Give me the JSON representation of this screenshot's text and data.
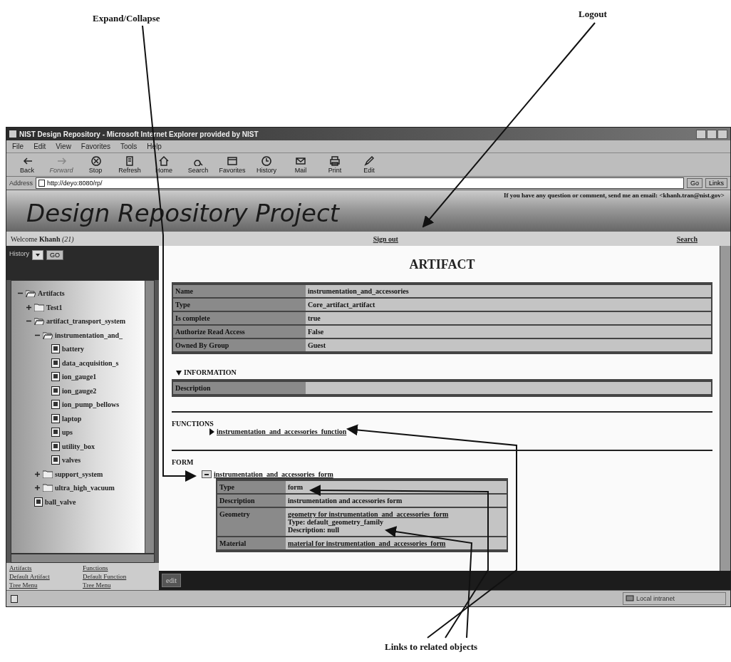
{
  "annotations": [
    {
      "kind": "label",
      "text": "Expand/Collapse"
    },
    {
      "kind": "label",
      "text": "Logout"
    },
    {
      "kind": "label",
      "text": "Links to related objects"
    }
  ],
  "window": {
    "title": "NIST Design Repository - Microsoft Internet Explorer provided by NIST"
  },
  "menu": [
    "File",
    "Edit",
    "View",
    "Favorites",
    "Tools",
    "Help"
  ],
  "toolbar": [
    {
      "label": "Back",
      "disabled": false
    },
    {
      "label": "Forward",
      "disabled": true
    },
    {
      "label": "Stop",
      "disabled": false
    },
    {
      "label": "Refresh",
      "disabled": false
    },
    {
      "label": "Home",
      "disabled": false
    },
    {
      "label": "Search",
      "disabled": false
    },
    {
      "label": "Favorites",
      "disabled": false
    },
    {
      "label": "History",
      "disabled": false
    },
    {
      "label": "Mail",
      "disabled": false
    },
    {
      "label": "Print",
      "disabled": false
    },
    {
      "label": "Edit",
      "disabled": false
    }
  ],
  "address_bar": {
    "label": "Address",
    "value": "http://deyo:8080/rp/",
    "go": "Go",
    "links": "Links"
  },
  "banner": {
    "contact": "If you have any question or comment, send me an email: <khanh.tran@nist.gov>",
    "title": "Design Repository Project"
  },
  "nav": {
    "welcome": "Welcome **Khanh** *(21)*",
    "sign_out": "Sign out",
    "search": "Search"
  },
  "sidebar": {
    "history_label": "History",
    "go": "GO",
    "tree": [
      {
        "label": "Artifacts",
        "kind": "folder",
        "expanded": true,
        "children": [
          {
            "label": "Test1",
            "kind": "folder",
            "expanded": false
          },
          {
            "label": "artifact_transport_system",
            "kind": "folder",
            "expanded": true,
            "children": [
              {
                "label": "instrumentation_and_",
                "kind": "folder",
                "expanded": true,
                "children": [
                  {
                    "label": "battery",
                    "kind": "file"
                  },
                  {
                    "label": "data_acquisition_s",
                    "kind": "file"
                  },
                  {
                    "label": "ion_gauge1",
                    "kind": "file"
                  },
                  {
                    "label": "ion_gauge2",
                    "kind": "file"
                  },
                  {
                    "label": "ion_pump_bellows",
                    "kind": "file"
                  },
                  {
                    "label": "laptop",
                    "kind": "file"
                  },
                  {
                    "label": "ups",
                    "kind": "file"
                  },
                  {
                    "label": "utility_box",
                    "kind": "file"
                  },
                  {
                    "label": "valves",
                    "kind": "file"
                  }
                ]
              },
              {
                "label": "support_system",
                "kind": "folder",
                "expanded": false
              },
              {
                "label": "ultra_high_vacuum",
                "kind": "folder",
                "expanded": false
              }
            ]
          },
          {
            "label": "ball_valve",
            "kind": "file"
          }
        ]
      }
    ],
    "links": [
      [
        "Artifacts",
        "Functions"
      ],
      [
        "Default Artifact",
        "Default Function"
      ],
      [
        "Tree Menu",
        "Tree Menu"
      ]
    ]
  },
  "main": {
    "heading": "ARTIFACT",
    "properties": [
      {
        "label": "Name",
        "value": "instrumentation_and_accessories"
      },
      {
        "label": "Type",
        "value": "Core_artifact_artifact"
      },
      {
        "label": "Is complete",
        "value": "true"
      },
      {
        "label": "Authorize Read Access",
        "value": "False"
      },
      {
        "label": "Owned By Group",
        "value": "Guest"
      }
    ],
    "information": {
      "label": "INFORMATION",
      "expanded": true,
      "rows": [
        {
          "label": "Description",
          "value": ""
        }
      ]
    },
    "functions": {
      "label": "FUNCTIONS",
      "items": [
        {
          "label": "instrumentation_and_accessories_function",
          "expanded": false
        }
      ]
    },
    "form": {
      "label": "FORM",
      "items": [
        {
          "label": "instrumentation_and_accessories_form",
          "expanded": true,
          "rows": [
            {
              "label": "Type",
              "lines": [
                {
                  "text": "form",
                  "link": false
                }
              ]
            },
            {
              "label": "Description",
              "lines": [
                {
                  "text": "instrumentation and accessories form",
                  "link": false
                }
              ]
            },
            {
              "label": "Geometry",
              "lines": [
                {
                  "text": "geometry for instrumentation_and_accessories_form",
                  "link": true
                },
                {
                  "text": "Type: default_geometry_family",
                  "link": false
                },
                {
                  "text": "Description: null",
                  "link": false
                }
              ]
            },
            {
              "label": "Material",
              "lines": [
                {
                  "text": "material for instrumentation_and_accessories_form",
                  "link": true
                }
              ]
            }
          ]
        }
      ]
    },
    "edit_button": "edit"
  },
  "status_bar": {
    "zone": "Local intranet"
  }
}
